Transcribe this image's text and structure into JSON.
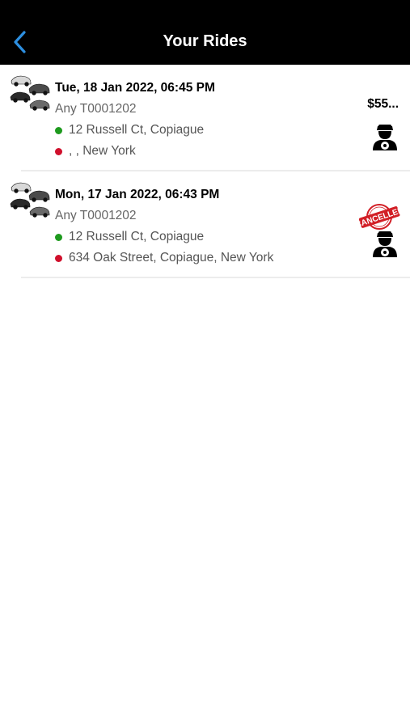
{
  "header": {
    "title": "Your Rides",
    "back_icon": "chevron-left-icon",
    "accent": "#2d8fe0",
    "background": "#000000"
  },
  "rides": [
    {
      "date": "Tue, 18 Jan 2022, 06:45 PM",
      "vehicle": "Any T0001202",
      "pickup": "12 Russell Ct,  Copiague",
      "dropoff": ", , New York",
      "fare": "$55...",
      "status": ""
    },
    {
      "date": "Mon, 17 Jan 2022, 06:43 PM",
      "vehicle": "Any T0001202",
      "pickup": "12 Russell Ct,  Copiague",
      "dropoff": "634 Oak Street, Copiague, New York",
      "fare": "",
      "status": "CANCELLED"
    }
  ],
  "colors": {
    "pickup_dot": "#1e9a1e",
    "dropoff_dot": "#d0102c",
    "stamp_red": "#d21f26"
  }
}
